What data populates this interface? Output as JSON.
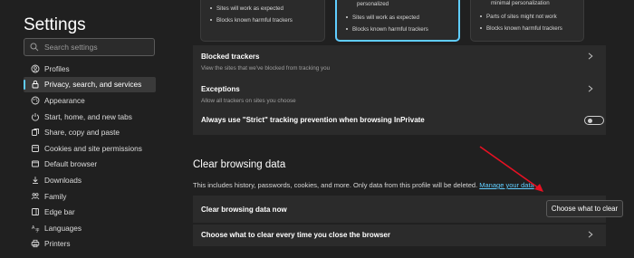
{
  "sidebar": {
    "title": "Settings",
    "search_placeholder": "Search settings",
    "items": [
      {
        "label": "Profiles",
        "icon": "profile-icon"
      },
      {
        "label": "Privacy, search, and services",
        "icon": "lock-icon",
        "active": true
      },
      {
        "label": "Appearance",
        "icon": "appearance-icon"
      },
      {
        "label": "Start, home, and new tabs",
        "icon": "power-icon"
      },
      {
        "label": "Share, copy and paste",
        "icon": "share-icon"
      },
      {
        "label": "Cookies and site permissions",
        "icon": "cookies-icon"
      },
      {
        "label": "Default browser",
        "icon": "browser-icon"
      },
      {
        "label": "Downloads",
        "icon": "download-icon"
      },
      {
        "label": "Family",
        "icon": "family-icon"
      },
      {
        "label": "Edge bar",
        "icon": "edge-bar-icon"
      },
      {
        "label": "Languages",
        "icon": "language-icon"
      },
      {
        "label": "Printers",
        "icon": "printer-icon"
      }
    ]
  },
  "tracking_cards": {
    "basic": [
      "Sites will work as expected",
      "Blocks known harmful trackers"
    ],
    "balanced": [
      "personalized",
      "Sites will work as expected",
      "Blocks known harmful trackers"
    ],
    "strict": [
      "minimal personalization",
      "Parts of sites might not work",
      "Blocks known harmful trackers"
    ]
  },
  "tracking": {
    "blocked_title": "Blocked trackers",
    "blocked_desc": "View the sites that we've blocked from tracking you",
    "exceptions_title": "Exceptions",
    "exceptions_desc": "Allow all trackers on sites you choose",
    "strict_inprivate_label": "Always use \"Strict\" tracking prevention when browsing InPrivate",
    "strict_inprivate_on": false
  },
  "clear_data": {
    "title": "Clear browsing data",
    "description": "This includes history, passwords, cookies, and more. Only data from this profile will be deleted.",
    "manage_link": "Manage your data",
    "now_label": "Clear browsing data now",
    "choose_button": "Choose what to clear",
    "every_close_label": "Choose what to clear every time you close the browser"
  },
  "colors": {
    "accent": "#60cdff",
    "annotation_arrow": "#e81123"
  }
}
